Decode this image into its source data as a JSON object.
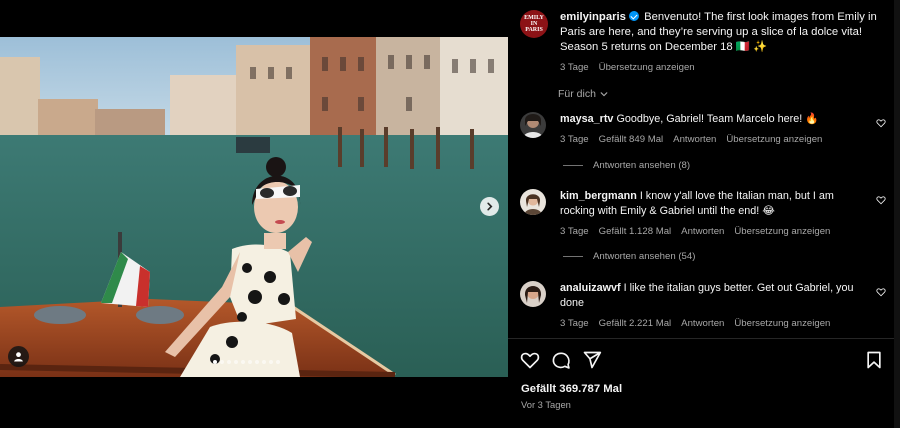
{
  "post": {
    "username": "emilyinparis",
    "avatar_text_top": "EMILY",
    "avatar_text_mid": "IN",
    "avatar_text_bottom": "PARIS",
    "caption": "Benvenuto! The first look images from Emily in Paris are here, and they’re serving up a slice of la dolce vita! Season 5 returns on December 18 🇮🇹 ✨",
    "time": "3 Tage",
    "translate": "Übersetzung anzeigen",
    "image_alt": "Woman in polka-dot dress and white sunglasses on a wooden boat in Venice",
    "carousel_count": 10,
    "carousel_active": 0
  },
  "filter": {
    "label": "Für dich"
  },
  "comments": [
    {
      "username": "maysa_rtv",
      "text": "Goodbye, Gabriel! Team Marcelo here! 🔥",
      "time": "3 Tage",
      "likes": "Gefällt 849 Mal",
      "reply": "Antworten",
      "translate": "Übersetzung anzeigen",
      "view_replies": "Antworten ansehen (8)"
    },
    {
      "username": "kim_bergmann",
      "text": "I know y'all love the Italian man, but I am rocking with Emily & Gabriel until the end! 😂",
      "time": "3 Tage",
      "likes": "Gefällt 1.128 Mal",
      "reply": "Antworten",
      "translate": "Übersetzung anzeigen",
      "view_replies": "Antworten ansehen (54)"
    },
    {
      "username": "analuizawvf",
      "text": "I like the italian guys better. Get out Gabriel, you done",
      "time": "3 Tage",
      "likes": "Gefällt 2.221 Mal",
      "reply": "Antworten",
      "translate": "Übersetzung anzeigen"
    }
  ],
  "footer": {
    "likes": "Gefällt 369.787 Mal",
    "ago": "Vor 3 Tagen"
  },
  "icons": {
    "like": "heart-icon",
    "comment": "comment-bubble-icon",
    "share": "paper-plane-icon",
    "save": "bookmark-icon",
    "next": "chevron-right-icon",
    "tag": "user-tag-icon",
    "verified": "verified-badge-icon",
    "filter": "chevron-down-icon"
  },
  "colors": {
    "background": "#000000",
    "text": "#f5f5f5",
    "muted": "#a8a8a8",
    "verified": "#0095f6",
    "brand": "#8c1216"
  }
}
